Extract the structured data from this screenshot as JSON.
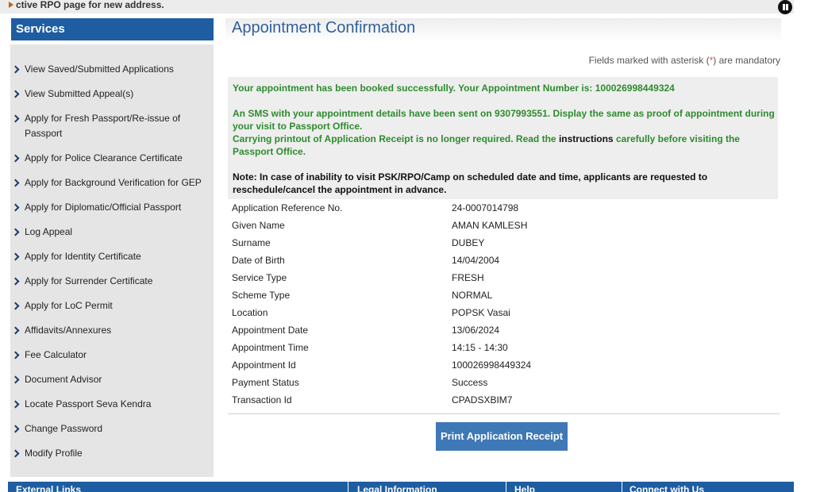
{
  "ticker": {
    "text": "ctive RPO page for new address."
  },
  "sidebar": {
    "header": "Services",
    "items": [
      {
        "label": "View Saved/Submitted Applications"
      },
      {
        "label": "View Submitted Appeal(s)"
      },
      {
        "label": "Apply for Fresh Passport/Re-issue of Passport"
      },
      {
        "label": "Apply for Police Clearance Certificate"
      },
      {
        "label": "Apply for Background Verification for GEP"
      },
      {
        "label": "Apply for Diplomatic/Official Passport"
      },
      {
        "label": "Log Appeal"
      },
      {
        "label": "Apply for Identity Certificate"
      },
      {
        "label": "Apply for Surrender Certificate"
      },
      {
        "label": "Apply for LoC Permit"
      },
      {
        "label": "Affidavits/Annexures"
      },
      {
        "label": "Fee Calculator"
      },
      {
        "label": "Document Advisor"
      },
      {
        "label": "Locate Passport Seva Kendra"
      },
      {
        "label": "Change Password"
      },
      {
        "label": "Modify Profile"
      }
    ]
  },
  "main": {
    "title": "Appointment Confirmation",
    "mandatory_prefix": "Fields marked with asterisk (",
    "mandatory_asterisk": "*",
    "mandatory_suffix": ") are mandatory",
    "messages": {
      "booked": "Your appointment has been booked successfully. Your Appointment Number is: 100026998449324",
      "sms": "An SMS with your appointment details have been sent on 9307993551. Display the same as proof of appointment during your visit to Passport Office.",
      "printout_pre": "Carrying printout of Application Receipt is no longer required. Read the ",
      "printout_link": "instructions",
      "printout_post": " carefully before visiting the Passport Office.",
      "note": "Note: In case of inability to visit PSK/RPO/Camp on scheduled date and time, applicants are requested to reschedule/cancel the appointment in advance."
    },
    "details": [
      {
        "label": "Application Reference No.",
        "value": "24-0007014798"
      },
      {
        "label": "Given Name",
        "value": "AMAN KAMLESH"
      },
      {
        "label": "Surname",
        "value": "DUBEY"
      },
      {
        "label": "Date of Birth",
        "value": "14/04/2004"
      },
      {
        "label": "Service Type",
        "value": "FRESH"
      },
      {
        "label": "Scheme Type",
        "value": "NORMAL"
      },
      {
        "label": "Location",
        "value": "POPSK Vasai"
      },
      {
        "label": "Appointment Date",
        "value": "13/06/2024"
      },
      {
        "label": "Appointment Time",
        "value": "14:15 - 14:30"
      },
      {
        "label": "Appointment Id",
        "value": "100026998449324"
      },
      {
        "label": "Payment Status",
        "value": "Success"
      },
      {
        "label": "Transaction Id",
        "value": "CPADSXBIM7"
      }
    ],
    "print_button": "Print Application Receipt"
  },
  "footer": {
    "columns": [
      "External Links",
      "Legal Information",
      "Help",
      "Connect with Us"
    ]
  },
  "colors": {
    "brand_blue": "#1e5da1",
    "button_blue": "#3f78b6",
    "success_green": "#2e8b2e",
    "title_blue": "#2f5f9c"
  }
}
